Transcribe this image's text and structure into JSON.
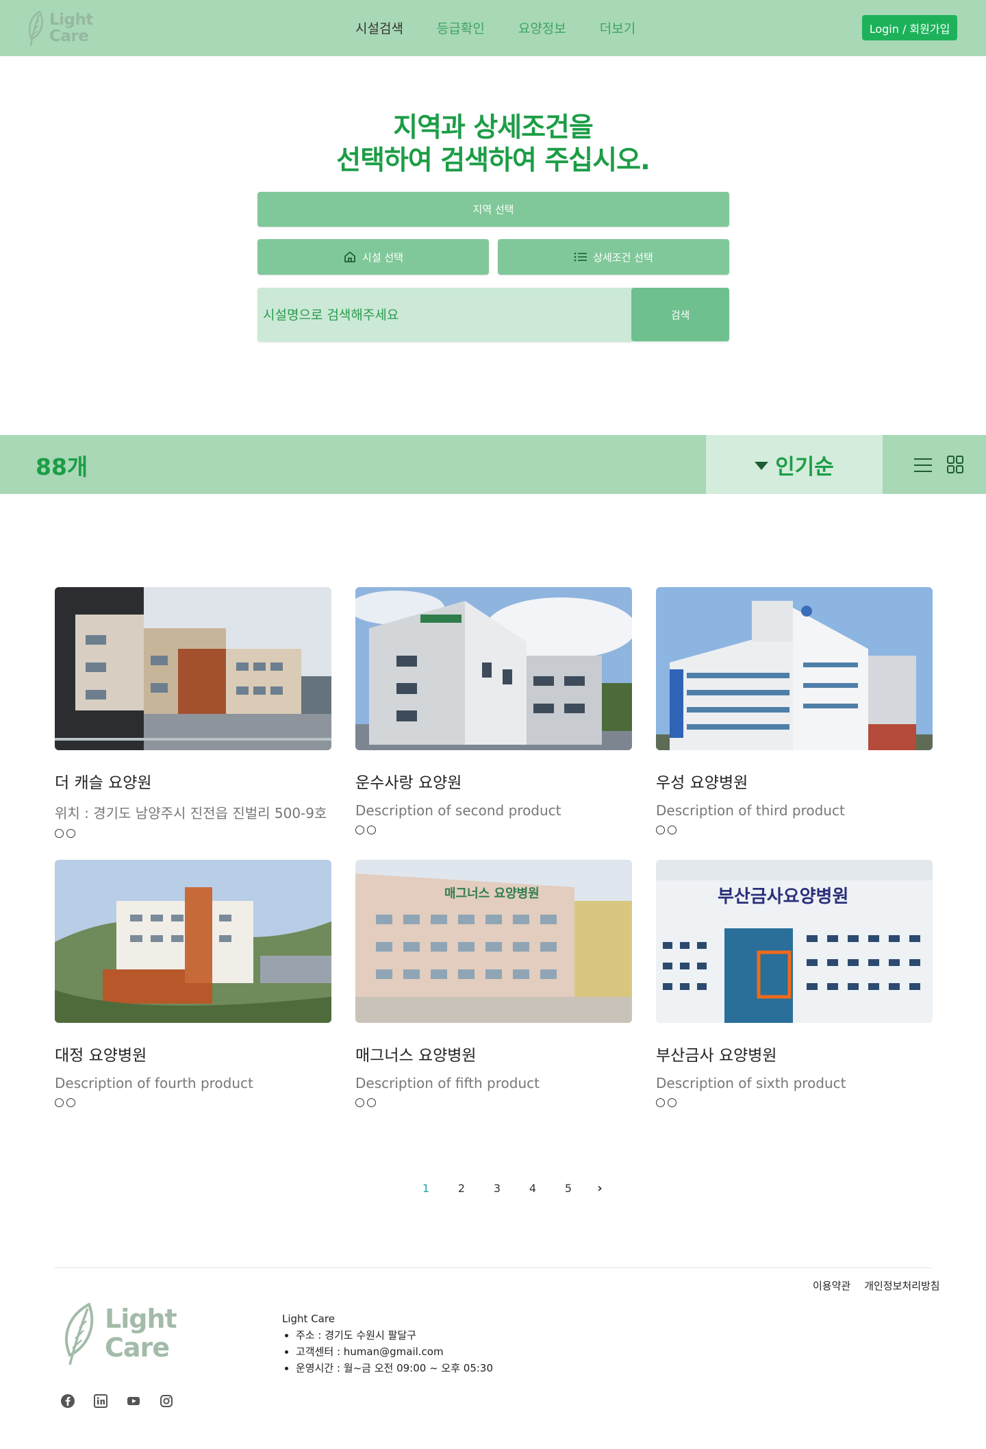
{
  "header": {
    "logo_line1": "Light",
    "logo_line2": "Care",
    "nav": [
      "시설검색",
      "등급확인",
      "요양정보",
      "더보기"
    ],
    "login_label": "Login / 회원가입"
  },
  "hero": {
    "title_line1": "지역과 상세조건을",
    "title_line2": "선택하여 검색하여 주십시오.",
    "region_label": "지역 선택",
    "facility_label": "시설 선택",
    "condition_label": "상세조건 선택",
    "search_placeholder": "시설명으로 검색해주세요",
    "search_label": "검색"
  },
  "results": {
    "count": "88개",
    "sort_label": "인기순"
  },
  "products": [
    {
      "title": "더 캐슬 요양원",
      "desc": "위치 : 경기도 남양주시 진전읍 진벌리 500-9호",
      "dots": "○○"
    },
    {
      "title": "운수사랑 요양원",
      "desc": "Description of second product",
      "dots": "○○"
    },
    {
      "title": "우성 요양병원",
      "desc": "Description of third product",
      "dots": "○○"
    },
    {
      "title": "대정 요양병원",
      "desc": "Description of fourth product",
      "dots": "○○"
    },
    {
      "title": "매그너스 요양병원",
      "desc": "Description of fifth product",
      "dots": "○○"
    },
    {
      "title": "부산금사 요양병원",
      "desc": "Description of sixth product",
      "dots": "○○"
    }
  ],
  "image_text": {
    "img5_sign": "매그너스 요양병원",
    "img6_sign": "부산금사요양병원"
  },
  "pagination": {
    "pages": [
      "1",
      "2",
      "3",
      "4",
      "5"
    ],
    "current": "1",
    "next": "›"
  },
  "footer": {
    "links": [
      "이용약관",
      "개인정보처리방침"
    ],
    "logo_line1": "Light",
    "logo_line2": "Care",
    "company": "Light Care",
    "info": [
      "주소 : 경기도 수원시 팔달구",
      "고객센터 : human@gmail.com",
      "운영시간 : 월~금 오전 09:00 ~ 오후 05:30"
    ],
    "socials": [
      "facebook-icon",
      "linkedin-icon",
      "youtube-icon",
      "instagram-icon"
    ]
  },
  "colors": {
    "header_bg": "#a8d8b6",
    "accent": "#1c9d46",
    "button": "#80c89a",
    "login": "#1db25a"
  }
}
